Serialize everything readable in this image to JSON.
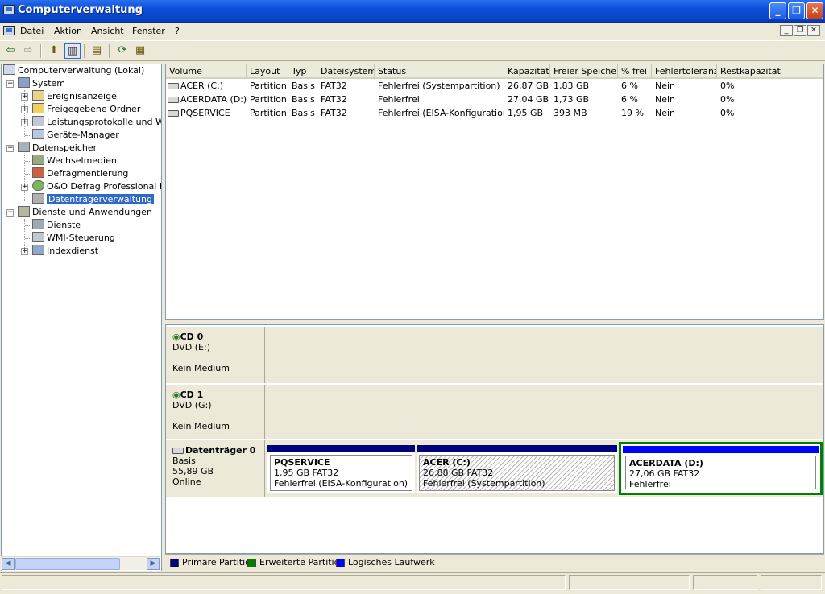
{
  "window": {
    "title": "Computerverwaltung"
  },
  "menu": {
    "items": [
      "Datei",
      "Aktion",
      "Ansicht",
      "Fenster",
      "?"
    ]
  },
  "tree": {
    "root": "Computerverwaltung (Lokal)",
    "system": "System",
    "system_items": [
      "Ereignisanzeige",
      "Freigegebene Ordner",
      "Leistungsprotokolle und Warn",
      "Geräte-Manager"
    ],
    "storage": "Datenspeicher",
    "storage_items": [
      "Wechselmedien",
      "Defragmentierung",
      "O&O Defrag Professional Edi",
      "Datenträgerverwaltung"
    ],
    "services": "Dienste und Anwendungen",
    "services_items": [
      "Dienste",
      "WMI-Steuerung",
      "Indexdienst"
    ]
  },
  "volume_list": {
    "columns": [
      "Volume",
      "Layout",
      "Typ",
      "Dateisystem",
      "Status",
      "Kapazität",
      "Freier Speicher",
      "% frei",
      "Fehlertoleranz",
      "Restkapazität"
    ],
    "rows": [
      [
        "ACER (C:)",
        "Partition",
        "Basis",
        "FAT32",
        "Fehlerfrei (Systempartition)",
        "26,87 GB",
        "1,83 GB",
        "6 %",
        "Nein",
        "0%"
      ],
      [
        "ACERDATA (D:)",
        "Partition",
        "Basis",
        "FAT32",
        "Fehlerfrei",
        "27,04 GB",
        "1,73 GB",
        "6 %",
        "Nein",
        "0%"
      ],
      [
        "PQSERVICE",
        "Partition",
        "Basis",
        "FAT32",
        "Fehlerfrei (EISA-Konfiguration)",
        "1,95 GB",
        "393 MB",
        "19 %",
        "Nein",
        "0%"
      ]
    ]
  },
  "disks": {
    "cd0": {
      "name": "CD 0",
      "drive": "DVD (E:)",
      "media": "Kein Medium"
    },
    "cd1": {
      "name": "CD 1",
      "drive": "DVD (G:)",
      "media": "Kein Medium"
    },
    "disk0": {
      "name": "Datenträger 0",
      "type": "Basis",
      "size": "55,89 GB",
      "state": "Online",
      "partitions": [
        {
          "name": "PQSERVICE",
          "fs": "1,95 GB FAT32",
          "status": "Fehlerfrei (EISA-Konfiguration)"
        },
        {
          "name": "ACER  (C:)",
          "fs": "26,88 GB FAT32",
          "status": "Fehlerfrei (Systempartition)"
        },
        {
          "name": "ACERDATA  (D:)",
          "fs": "27,06 GB FAT32",
          "status": "Fehlerfrei"
        }
      ]
    }
  },
  "legend": {
    "items": [
      "Primäre Partition",
      "Erweiterte Partition",
      "Logisches Laufwerk"
    ],
    "colors": [
      "#00007b",
      "#008000",
      "#0000ff"
    ]
  }
}
